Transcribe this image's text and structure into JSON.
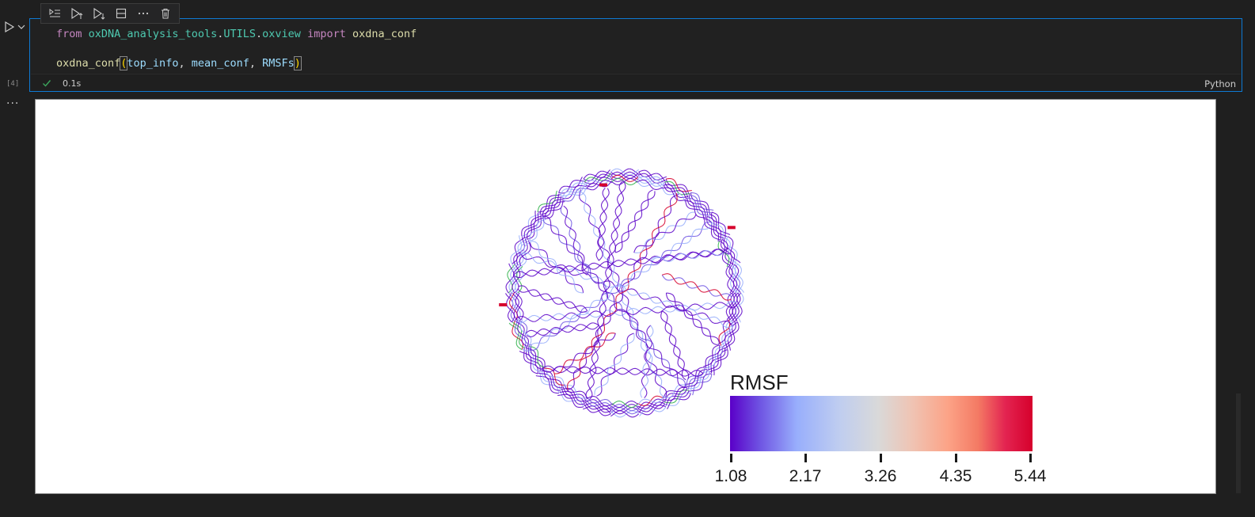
{
  "cell": {
    "execution_count": "[4]",
    "code_line1": {
      "kw_from": "from",
      "module": "oxDNA_analysis_tools",
      "dot1": ".",
      "sub1": "UTILS",
      "dot2": ".",
      "sub2": "oxview",
      "kw_import": "import",
      "name": "oxdna_conf"
    },
    "code_line2": {
      "func": "oxdna_conf",
      "open": "(",
      "arg1": "top_info",
      "comma1": ", ",
      "arg2": "mean_conf",
      "comma2": ", ",
      "arg3": "RMSFs",
      "close": ")"
    },
    "status": {
      "icon": "check-icon",
      "time": "0.1s"
    },
    "language": "Python"
  },
  "toolbar": {
    "icons": [
      "run-by-line-icon",
      "execute-above-icon",
      "execute-below-icon",
      "split-cell-icon",
      "more-icon",
      "delete-icon"
    ]
  },
  "output": {
    "more_label": "···",
    "colorbar": {
      "title": "RMSF",
      "ticks": [
        "1.08",
        "2.17",
        "3.26",
        "4.35",
        "5.44"
      ],
      "colors": [
        "#5a00c8",
        "#98aefc",
        "#d9d9d9",
        "#fca387",
        "#d6002c"
      ]
    }
  },
  "colors": {
    "accent": "#0e7ad4",
    "success": "#3ca55c"
  }
}
